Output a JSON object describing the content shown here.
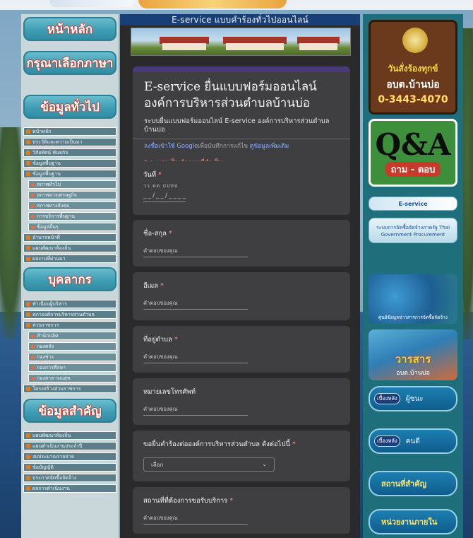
{
  "left_sidebar": {
    "banners": [
      "หน้าหลัก",
      "กรุณาเลือกภาษา",
      "ข้อมูลทั่วไป",
      "บุคลากร",
      "ข้อมูลสำคัญ"
    ],
    "menu_general": [
      "หน้าหลัก",
      "ประวัติและความเป็นมา",
      "วิสัยทัศน์ พันธกิจ",
      "ข้อมูลพื้นฐาน",
      "ข้อมูลพื้นฐาน"
    ],
    "menu_general_sub": [
      "สภาพทั่วไป",
      "สภาพทางเศรษฐกิจ",
      "สภาพทางสังคม",
      "การบริการพื้นฐาน",
      "ข้อมูลอื่นๆ"
    ],
    "menu_general_tail": [
      "อำนาจหน้าที่",
      "แผนพัฒนาท้องถิ่น",
      "ผลงานที่ผ่านมา"
    ],
    "menu_staff": [
      "ทำเนียบผู้บริหาร",
      "สภาองค์การบริหารส่วนตำบล",
      "ส่วนราชการ"
    ],
    "menu_staff_sub": [
      "สำนักปลัด",
      "กองคลัง",
      "กองช่าง",
      "กองการศึกษา",
      "กองสาธารณสุข"
    ],
    "menu_staff_tail": [
      "โครงสร้างส่วนราชการ"
    ],
    "menu_important": [
      "แผนพัฒนาท้องถิ่น",
      "แผนดำเนินงานประจำปี",
      "งบประมาณรายจ่าย",
      "ข้อบัญญัติ",
      "ประกาศจัดซื้อจัดจ้าง",
      "ผลการดำเนินงาน"
    ]
  },
  "center": {
    "header": "E-service แบบคำร้องทั่วไปออนไลน์",
    "form_title": "E-service ยื่นแบบฟอร์มออนไลน์ องค์การบริหารส่วนตำบลบ้านบ่อ",
    "form_desc": "ระบบยื่นแบบฟอร์มออนไลน์ E-service องค์การบริหารส่วนตำบลบ้านบ่อ",
    "signin_link": "ลงชื่อเข้าใช้ Google",
    "signin_rest": "เพื่อบันทึกการแก้ไข ",
    "more_info": "ดูข้อมูลเพิ่มเติม",
    "required_note": "* ระบุว่าเป็นคำถามที่จำเป็น",
    "questions": [
      {
        "label": "วันที่",
        "required": true,
        "type": "date",
        "hint": "วว  ดด  ปปปป",
        "value": "__/__/____"
      },
      {
        "label": "ชื่อ-สกุล",
        "required": true,
        "type": "text",
        "placeholder": "คำตอบของคุณ"
      },
      {
        "label": "อีเมล",
        "required": true,
        "type": "text",
        "placeholder": "คำตอบของคุณ"
      },
      {
        "label": "ที่อยู่ตำบล",
        "required": true,
        "type": "text",
        "placeholder": "คำตอบของคุณ"
      },
      {
        "label": "หมายเลขโทรศัพท์",
        "required": false,
        "type": "text",
        "placeholder": "คำตอบของคุณ"
      },
      {
        "label": "ขอยื่นคำร้องต่อองค์การบริหารส่วนตำบล ดังต่อไปนี้",
        "required": true,
        "type": "select",
        "selected": "เลือก"
      },
      {
        "label": "สถานที่ที่ต้องการขอรับบริการ",
        "required": true,
        "type": "text",
        "placeholder": "คำตอบของคุณ"
      }
    ]
  },
  "right_sidebar": {
    "contact_line1": "วันสั่งร้องทุกข์",
    "contact_line2": "อบต.บ้านบ่อ",
    "contact_phone": "0-3443-4070",
    "qa_big": "Q&A",
    "qa_sub": "ถาม - ตอบ",
    "eservice": "E-service",
    "procurement": "ระบบการจัดซื้อจัดจ้างภาครัฐ Thai Government Procurement",
    "info_center": "ศูนย์ข้อมูลข่าวสารการจัดซื้อจัดจ้าง",
    "journal_title": "วารสาร",
    "journal_sub": "อบต.บ้านบ่อ",
    "pill_1_tag": "เบื้องหลัง",
    "pill_1_text": "ผู้ชนะ",
    "pill_2_tag": "เบื้องหลัง",
    "pill_2_text": "คนดี",
    "pill_3_text": "สถานที่สำคัญ",
    "pill_4_text": "หน่วยงานภายใน"
  },
  "colors": {
    "form_bg": "#2a2a2b",
    "card_bg": "#3f3f41",
    "accent_purple": "#4a3a7a",
    "header_blue": "#183f77",
    "required_red": "#ff8f85",
    "link_blue": "#8ab1ff"
  }
}
